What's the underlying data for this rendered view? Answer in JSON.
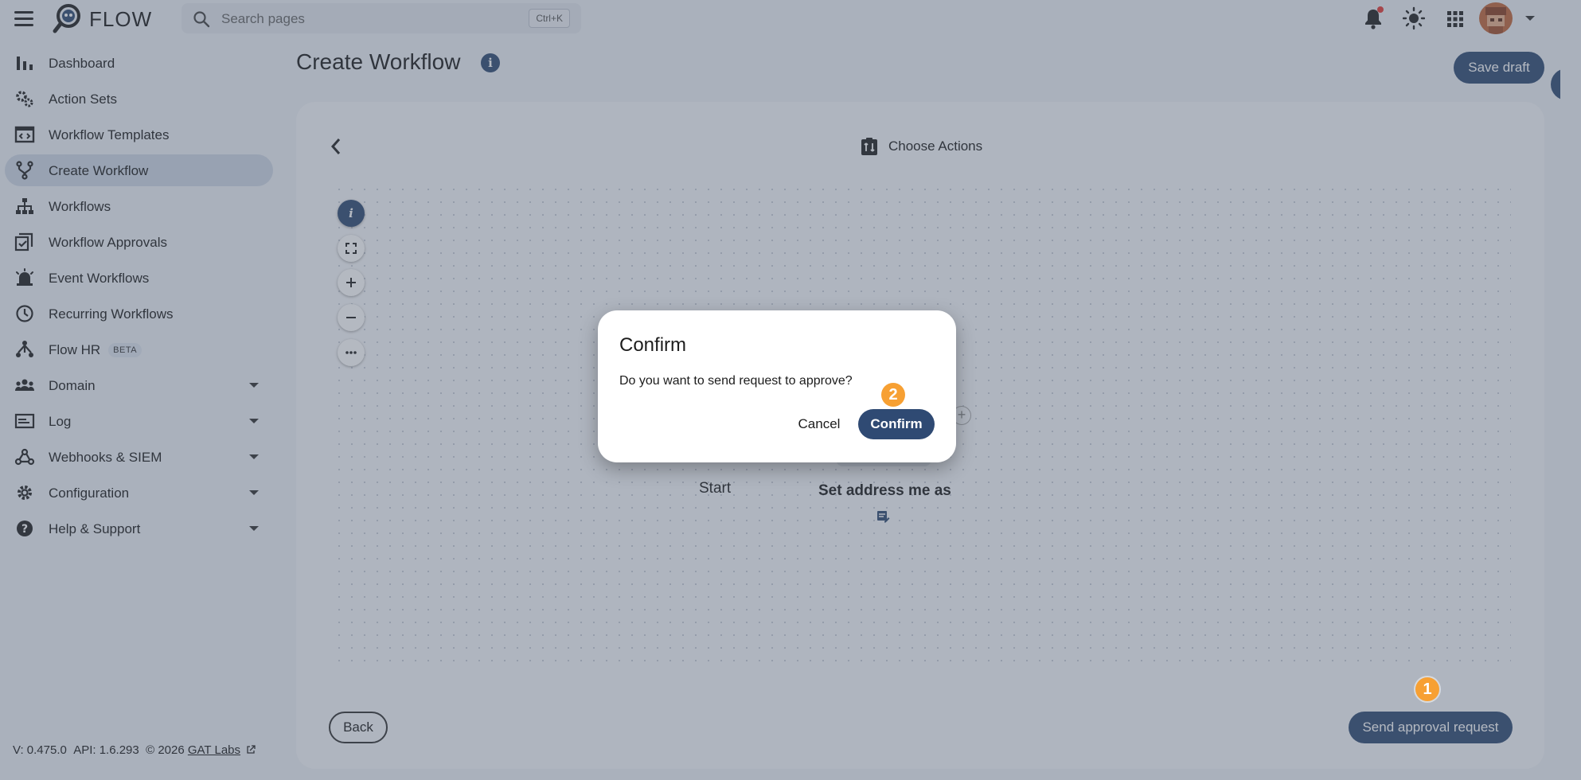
{
  "app": {
    "name": "FLOW"
  },
  "search": {
    "placeholder": "Search pages",
    "shortcut": "Ctrl+K"
  },
  "sidebar": {
    "items": [
      {
        "label": "Dashboard",
        "icon": "bar-chart-icon"
      },
      {
        "label": "Action Sets",
        "icon": "gears-icon"
      },
      {
        "label": "Workflow Templates",
        "icon": "template-icon"
      },
      {
        "label": "Create Workflow",
        "icon": "fork-icon",
        "active": true
      },
      {
        "label": "Workflows",
        "icon": "sitemap-icon"
      },
      {
        "label": "Workflow Approvals",
        "icon": "approval-icon"
      },
      {
        "label": "Event Workflows",
        "icon": "alarm-icon"
      },
      {
        "label": "Recurring Workflows",
        "icon": "clock-icon"
      },
      {
        "label": "Flow HR",
        "icon": "hr-icon",
        "badge": "BETA"
      },
      {
        "label": "Domain",
        "icon": "group-icon",
        "expandable": true
      },
      {
        "label": "Log",
        "icon": "log-icon",
        "expandable": true
      },
      {
        "label": "Webhooks & SIEM",
        "icon": "webhook-icon",
        "expandable": true
      },
      {
        "label": "Configuration",
        "icon": "gear-icon",
        "expandable": true
      },
      {
        "label": "Help & Support",
        "icon": "help-icon",
        "expandable": true
      }
    ]
  },
  "footer": {
    "version": "V: 0.475.0",
    "api": "API: 1.6.293",
    "copyright": "© 2026",
    "link": "GAT Labs"
  },
  "page": {
    "title": "Create Workflow",
    "save_draft": "Save draft"
  },
  "workflow": {
    "header": "Choose Actions",
    "start_node": "Start",
    "action_node": "Set address me as",
    "back": "Back",
    "send": "Send approval request"
  },
  "dialog": {
    "title": "Confirm",
    "message": "Do you want to send request to approve?",
    "cancel": "Cancel",
    "confirm": "Confirm"
  },
  "annotations": {
    "step1": "1",
    "step2": "2"
  },
  "colors": {
    "primary": "#2f4a73",
    "badge": "#f7a033",
    "notification": "#e53935"
  }
}
